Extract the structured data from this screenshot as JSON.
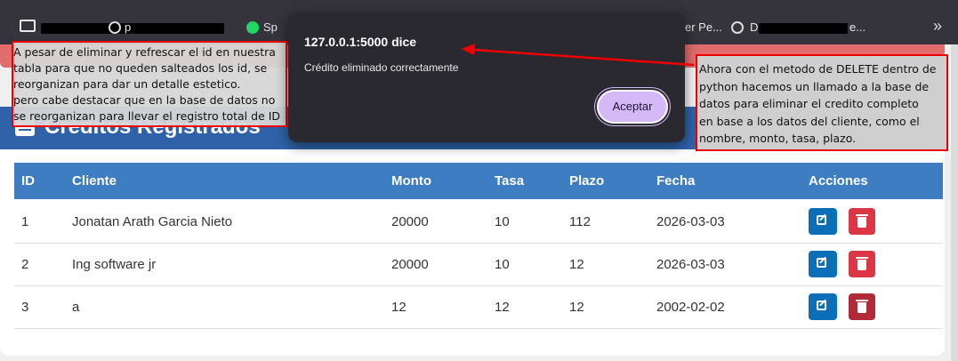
{
  "bookmarks": {
    "partial_label_1": "p",
    "partial_label_2": "Sp",
    "partial_label_3": "er Pe...",
    "partial_label_4": "D",
    "partial_label_5": "e..."
  },
  "header": {
    "title": "Créditos Registrados"
  },
  "table": {
    "columns": [
      "ID",
      "Cliente",
      "Monto",
      "Tasa",
      "Plazo",
      "Fecha",
      "Acciones"
    ],
    "rows": [
      {
        "id": "1",
        "cliente": "Jonatan Arath Garcia Nieto",
        "monto": "20000",
        "tasa": "10",
        "plazo": "112",
        "fecha": "2026-03-03"
      },
      {
        "id": "2",
        "cliente": "Ing software jr",
        "monto": "20000",
        "tasa": "10",
        "plazo": "12",
        "fecha": "2026-03-03"
      },
      {
        "id": "3",
        "cliente": "a",
        "monto": "12",
        "tasa": "12",
        "plazo": "12",
        "fecha": "2002-02-02"
      }
    ]
  },
  "dialog": {
    "title": "127.0.0.1:5000 dice",
    "message": "Crédito eliminado correctamente",
    "accept_label": "Aceptar"
  },
  "annotation_left": {
    "lines": [
      "A pesar de eliminar y refrescar el id en nuestra",
      "tabla para que no queden salteados los id, se",
      "reorganizan para dar un detalle estetico.",
      "pero cabe destacar que en la base de datos no",
      "se reorganizan para llevar el registro total de ID"
    ]
  },
  "annotation_right": {
    "lines": [
      "Ahora con el metodo de DELETE dentro de",
      "python hacemos un llamado a la base de",
      "datos para eliminar el credito completo",
      "en base a los datos del cliente, como el",
      "nombre, monto, tasa, plazo."
    ]
  },
  "colors": {
    "header": "#2f62a8",
    "table_header": "#3f7dc2",
    "edit_button": "#0b6fb8",
    "delete_button": "#dc3545",
    "dialog_button": "#d4b8f8",
    "annotation_border": "#ee0000"
  }
}
